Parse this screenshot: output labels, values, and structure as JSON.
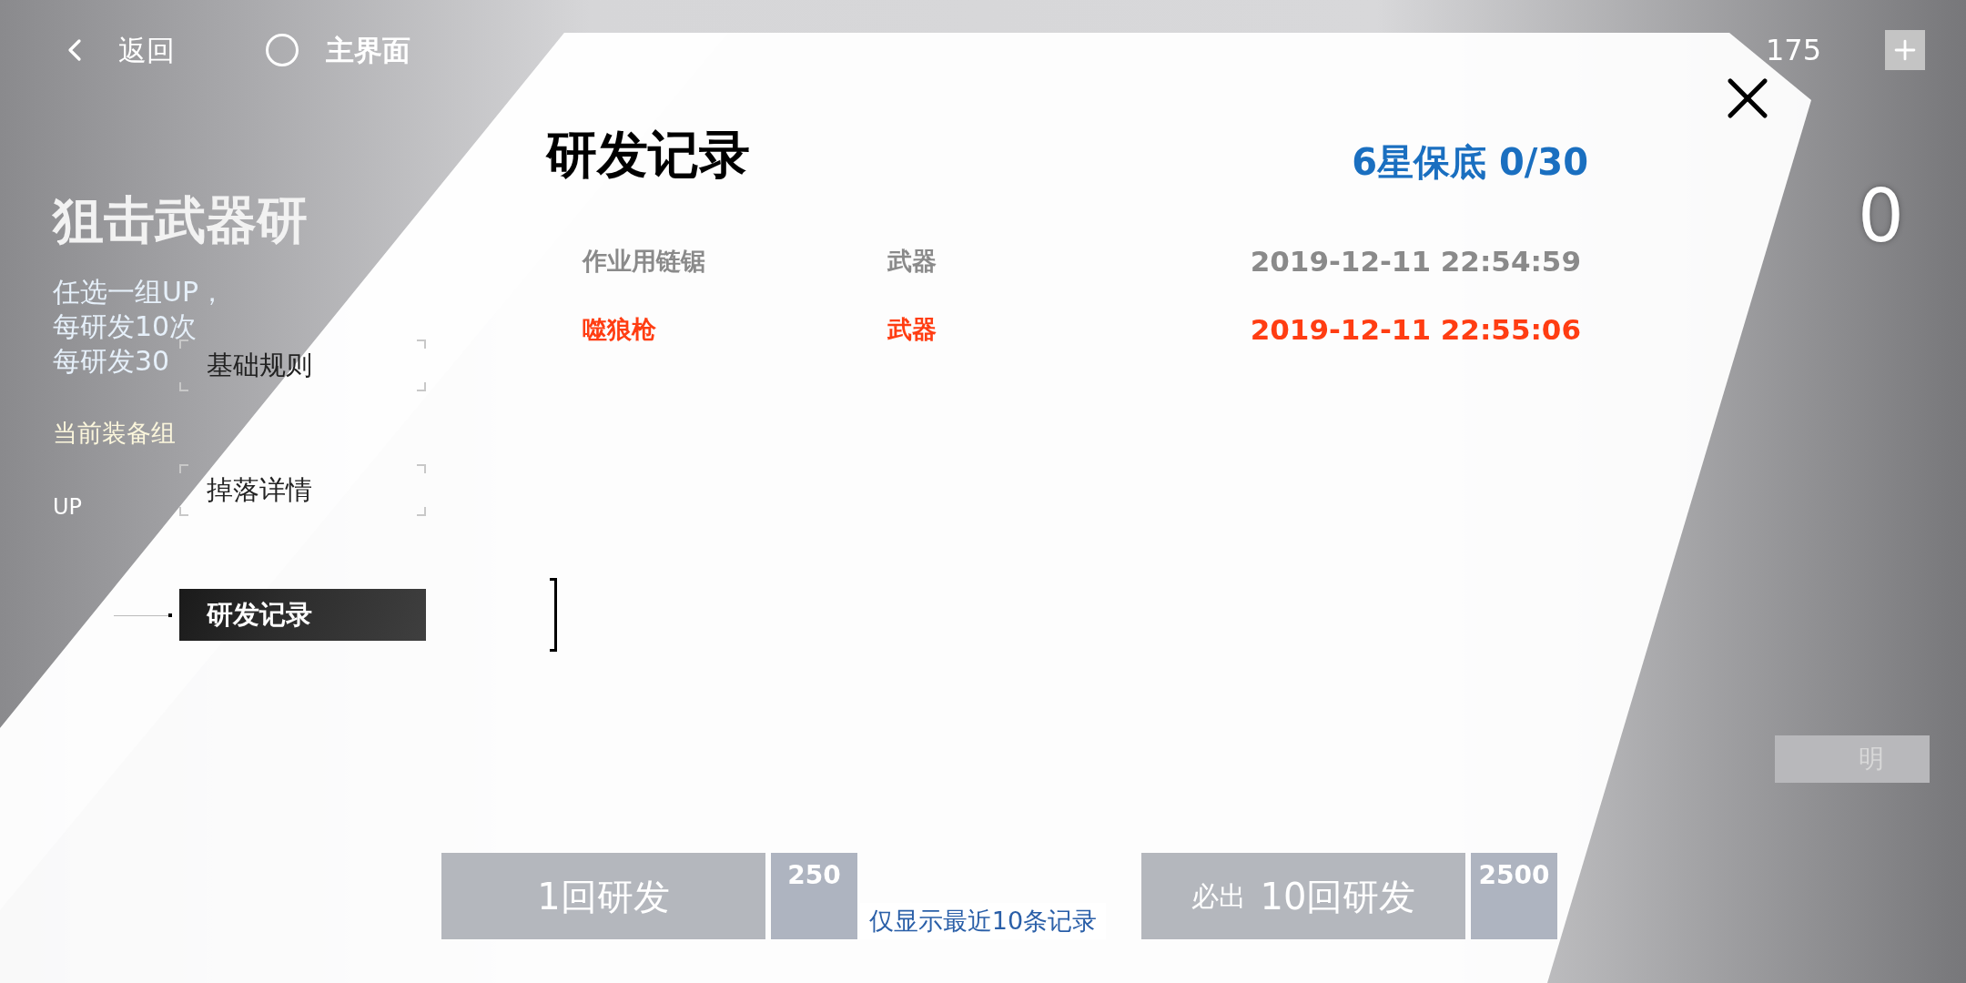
{
  "top_bar": {
    "back": "返回",
    "home": "主界面",
    "currency": "175"
  },
  "background": {
    "title": "狙击武器研",
    "lines": [
      "任选一组UP，",
      "每研发10次",
      "每研发30"
    ],
    "equip_label": "当前装备组",
    "up_label": "UP",
    "counter": "0",
    "help_label": "明",
    "draw_buttons": [
      {
        "label": "1回研发",
        "cost": "250"
      },
      {
        "label": "10回研发",
        "cost": "2500",
        "note": "必出"
      }
    ]
  },
  "tabs": [
    {
      "label": "基础规则",
      "selected": false
    },
    {
      "label": "掉落详情",
      "selected": false
    },
    {
      "label": "研发记录",
      "selected": true
    }
  ],
  "dialog": {
    "title": "研发记录",
    "pity": "6星保底 0/30",
    "records": [
      {
        "name": "作业用链锯",
        "type": "武器",
        "time": "2019-12-11 22:54:59",
        "color": "#8a8a8a"
      },
      {
        "name": "噬狼枪",
        "type": "武器",
        "time": "2019-12-11 22:55:06",
        "color": "#ff3d12"
      }
    ],
    "footer": "仅显示最近10条记录"
  }
}
